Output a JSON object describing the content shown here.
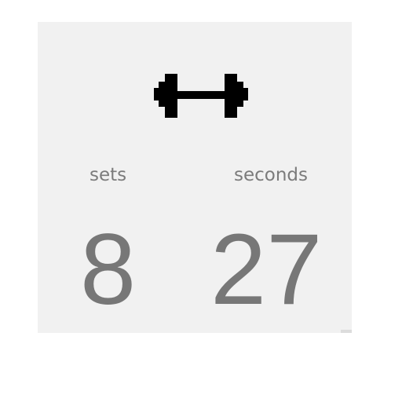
{
  "workout": {
    "icon": "dumbbell-icon",
    "sets_label": "sets",
    "seconds_label": "seconds",
    "sets_value": "8",
    "seconds_value": "27"
  },
  "colors": {
    "card_background": "#f1f1f1",
    "text_gray": "#777777",
    "icon_black": "#000000"
  }
}
